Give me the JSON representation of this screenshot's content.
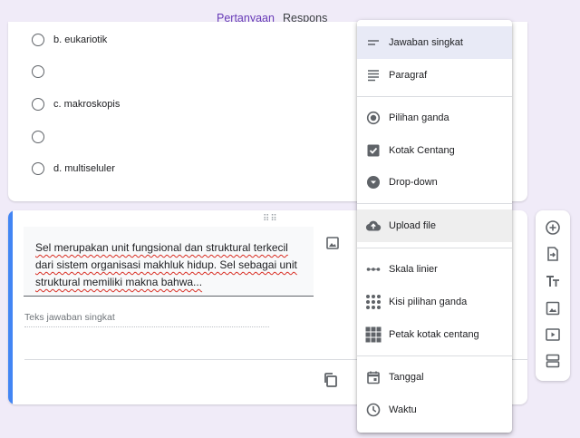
{
  "tabs": {
    "questions": "Pertanyaan",
    "responses": "Respons"
  },
  "options": [
    {
      "label": "b. eukariotik"
    },
    {
      "label": ""
    },
    {
      "label": "c. makroskopis"
    },
    {
      "label": ""
    },
    {
      "label": "d. multiseluler"
    }
  ],
  "question": {
    "text_parts": [
      "Sel merupakan unit fungsional dan struktural terkecil",
      "dari sistem organisasi makhluk hidup. Sel sebagai unit",
      "struktural memiliki makna bahwa..."
    ],
    "answer_placeholder": "Teks jawaban singkat"
  },
  "menu": {
    "items": [
      {
        "label": "Jawaban singkat",
        "icon": "short-text-icon"
      },
      {
        "label": "Paragraf",
        "icon": "paragraph-icon"
      },
      {
        "label": "Pilihan ganda",
        "icon": "radio-button-icon"
      },
      {
        "label": "Kotak Centang",
        "icon": "checkbox-icon"
      },
      {
        "label": "Drop-down",
        "icon": "dropdown-icon"
      },
      {
        "label": "Upload file",
        "icon": "cloud-upload-icon"
      },
      {
        "label": "Skala linier",
        "icon": "linear-scale-icon"
      },
      {
        "label": "Kisi pilihan ganda",
        "icon": "grid-dots-icon"
      },
      {
        "label": "Petak kotak centang",
        "icon": "grid-squares-icon"
      },
      {
        "label": "Tanggal",
        "icon": "calendar-icon"
      },
      {
        "label": "Waktu",
        "icon": "clock-icon"
      }
    ]
  },
  "toolbar": {
    "icons": [
      "add-question-icon",
      "import-questions-icon",
      "add-title-icon",
      "add-image-icon",
      "add-video-icon",
      "add-section-icon"
    ]
  },
  "colors": {
    "accent": "#673ab7",
    "focus_bar": "#4285f4",
    "background": "#f0ebf8",
    "menu_highlight": "#e8eaf6"
  }
}
